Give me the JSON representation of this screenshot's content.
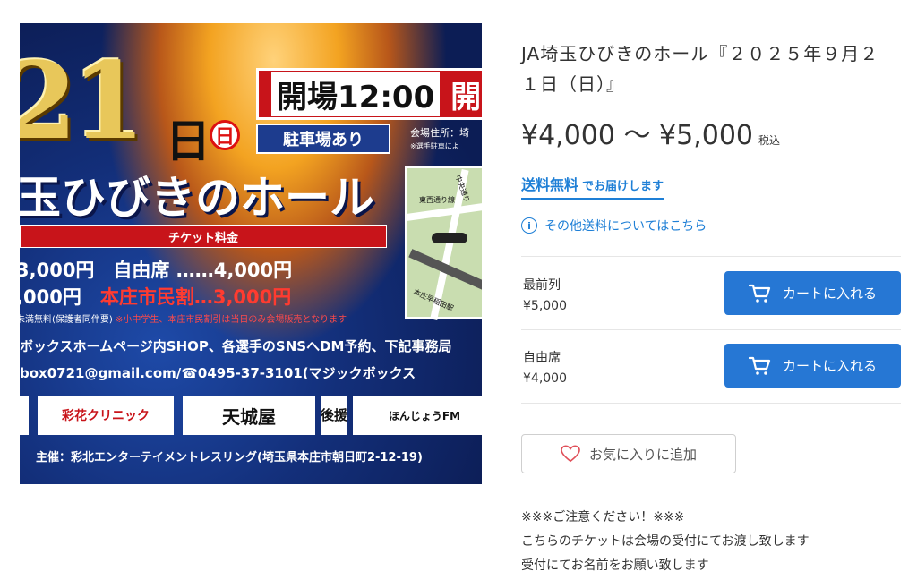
{
  "poster": {
    "big_date": "21",
    "day_char": "日",
    "weekday": "日",
    "open_text": "開場12:00",
    "open_text_cut": "開",
    "parking": "駐車場あり",
    "venue_addr": "会場住所：埼",
    "venue_note": "※選手駐車によ",
    "hall_name": "玉ひびきのホール",
    "map_label_1": "東西通り線",
    "map_label_2": "中央通り",
    "map_label_3": "本庄早稲田駅",
    "ticket_header": "チケット料金",
    "price_row_1": "3,000円　自由席 ……4,000円",
    "price_row_2_a": ",000円　",
    "price_row_2_b": "本庄市民割…3,000円",
    "notes_a": "未満無料(保護者同伴要)",
    "notes_b": "※小中学生、本庄市民割引は当日のみ会場販売となります",
    "line_1": "ボックスホームページ内SHOP、各選手のSNSへDM予約、下記事務局",
    "line_2": "box0721@gmail.com/☎0495-37-3101(マジックボックス",
    "sponsor_clinic": "彩花クリニック",
    "sponsor_amagi": "天城屋",
    "sponsor_ato": "後援",
    "sponsor_fm": "ほんじょうFM",
    "organizer": "主催：彩北エンターテイメントレスリング(埼玉県本庄市朝日町2-12-19)"
  },
  "product": {
    "title": "JA埼玉ひびきのホール『２０２５年９月２１日（日）』",
    "price_range": "¥4,000 〜 ¥5,000",
    "tax_label": "税込",
    "free_shipping_strong": "送料無料",
    "free_shipping_rest": "でお届けします",
    "other_shipping": "その他送料についてはこちら",
    "info_icon": "i"
  },
  "variants": [
    {
      "name": "最前列",
      "price": "¥5,000",
      "cart_label": "カートに入れる"
    },
    {
      "name": "自由席",
      "price": "¥4,000",
      "cart_label": "カートに入れる"
    }
  ],
  "favorite_label": "お気に入りに追加",
  "notice": {
    "line_1": "※※※ご注意ください！※※※",
    "line_2": "こちらのチケットは会場の受付にてお渡し致します",
    "line_3": "受付にてお名前をお願い致します"
  },
  "colors": {
    "accent_blue": "#2677d4",
    "link_blue": "#1e7fd6",
    "poster_red": "#c8141a"
  }
}
